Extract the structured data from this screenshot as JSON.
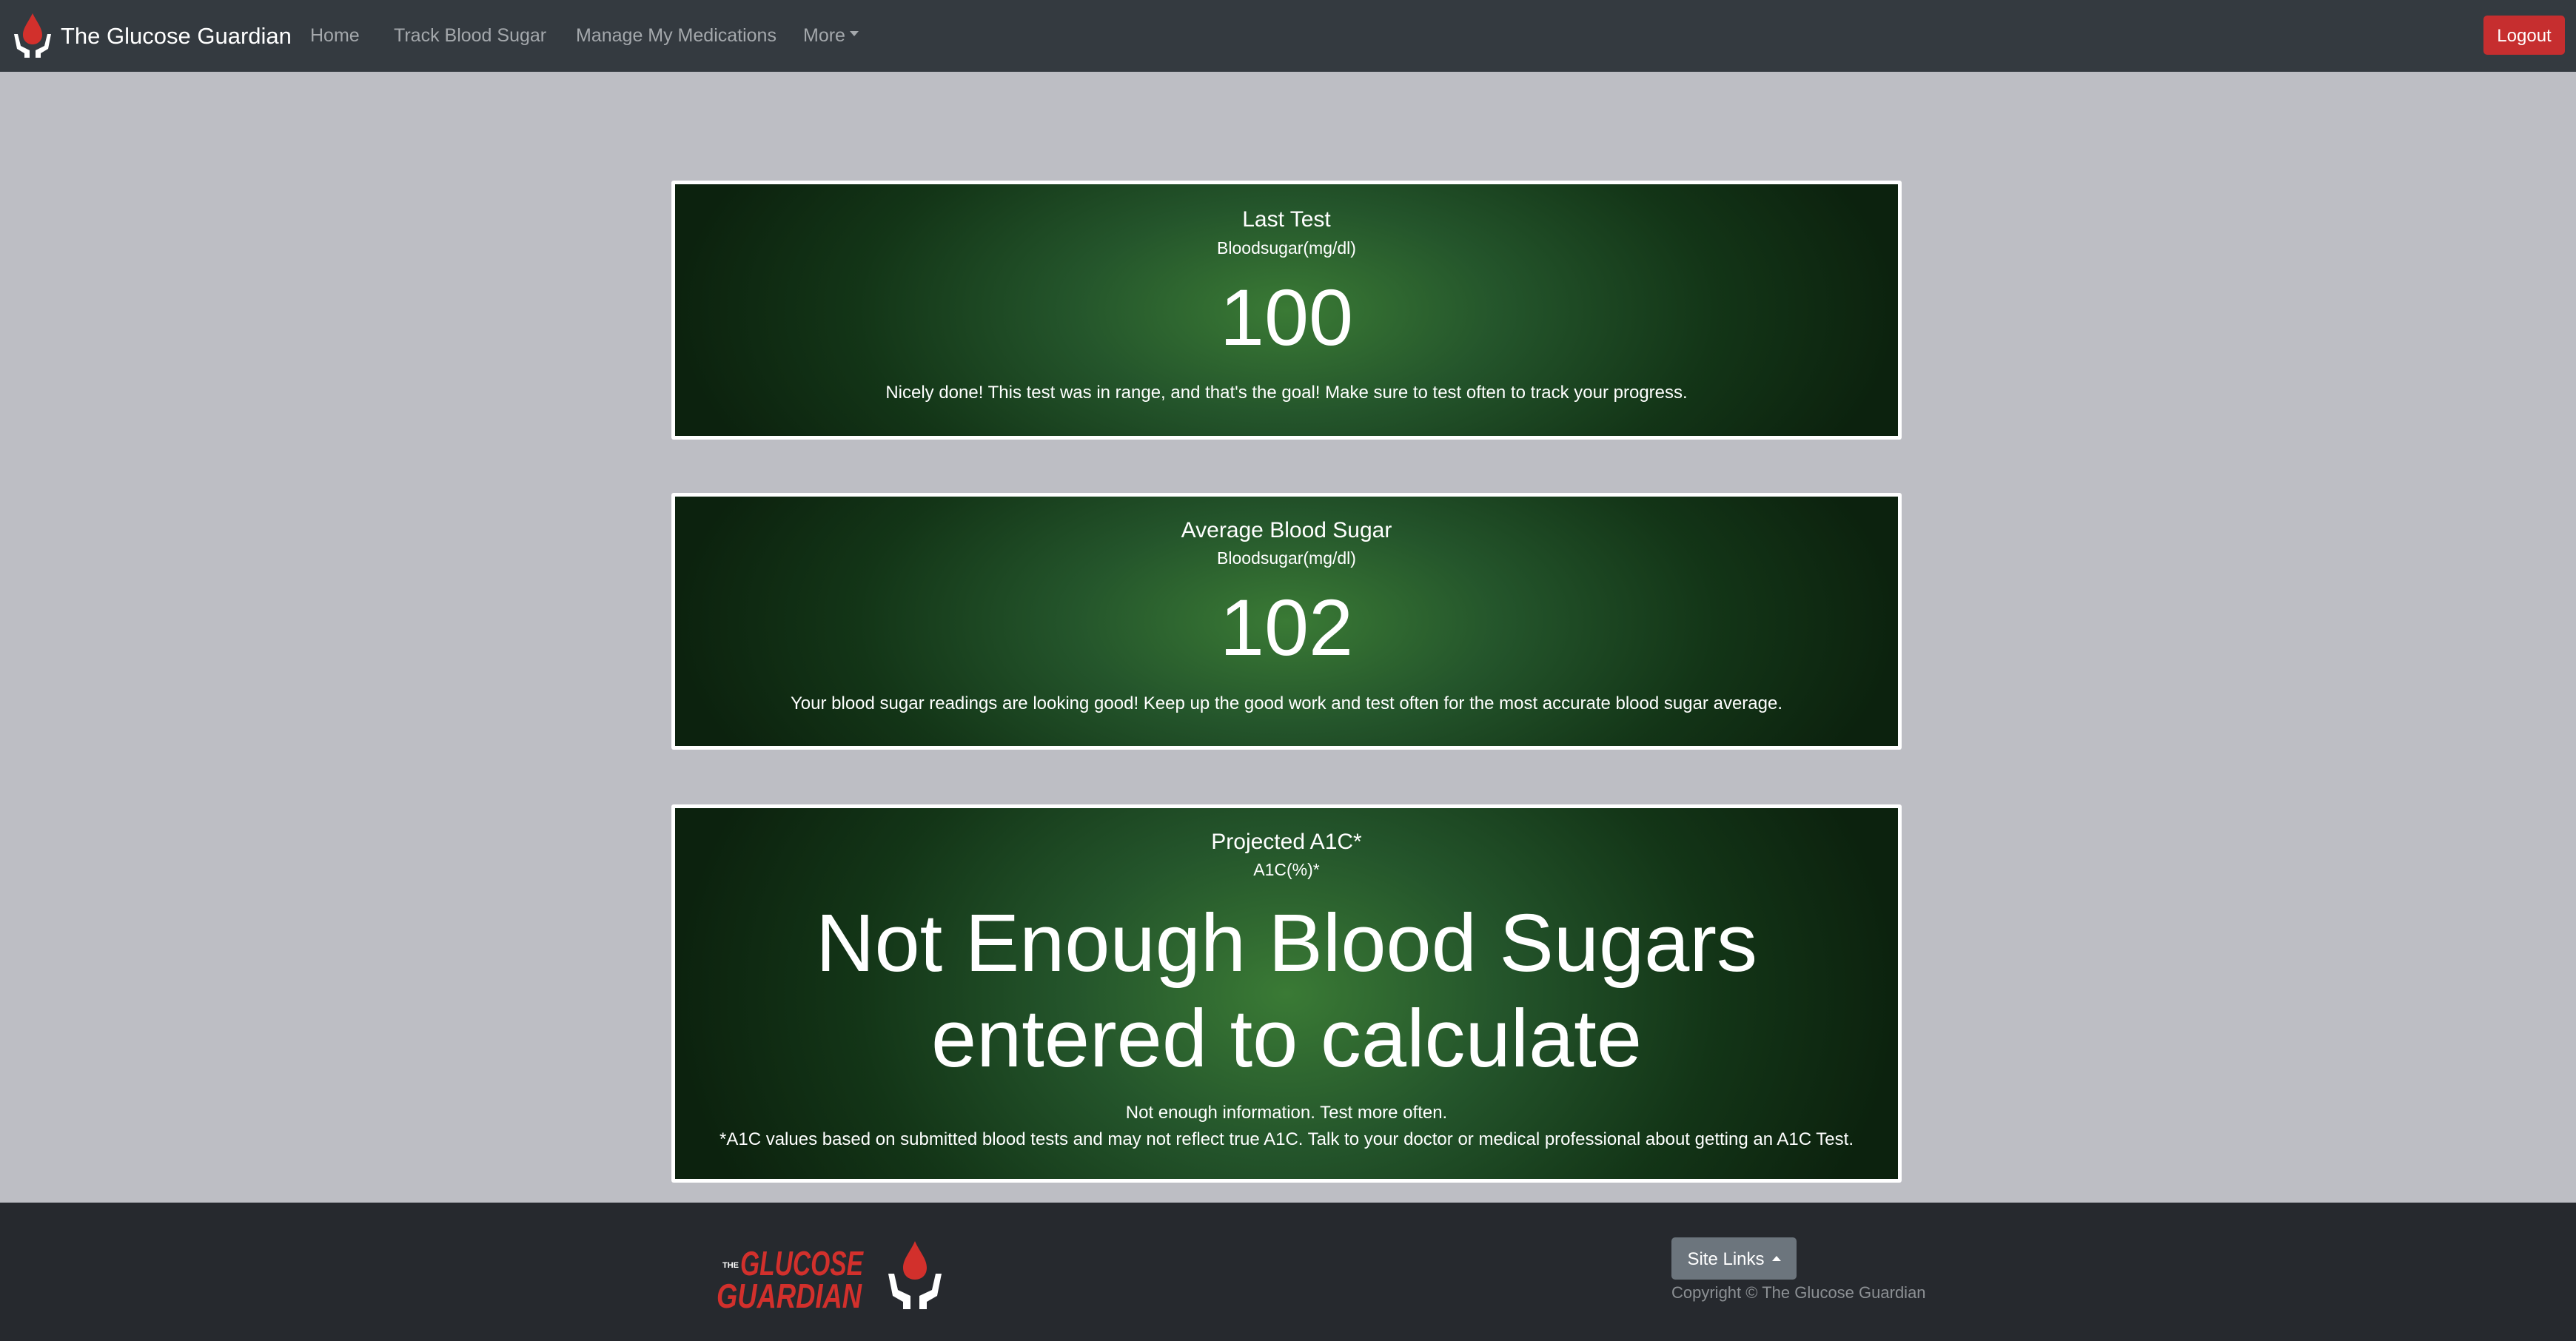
{
  "navbar": {
    "brand": "The Glucose Guardian",
    "links": [
      "Home",
      "Track Blood Sugar",
      "Manage My Medications",
      "More"
    ],
    "logout_label": "Logout"
  },
  "cards": {
    "last_test": {
      "title": "Last Test",
      "subtitle": "Bloodsugar(mg/dl)",
      "value": "100",
      "message": "Nicely done! This test was in range, and that's the goal! Make sure to test often to track your progress."
    },
    "average": {
      "title": "Average Blood Sugar",
      "subtitle": "Bloodsugar(mg/dl)",
      "value": "102",
      "message": "Your blood sugar readings are looking good! Keep up the good work and test often for the most accurate blood sugar average."
    },
    "a1c": {
      "title": "Projected A1C*",
      "subtitle": "A1C(%)*",
      "value_line1": "Not Enough Blood Sugars",
      "value_line2": "entered to calculate",
      "message": "Not enough information. Test more often.",
      "disclaimer": "*A1C values based on submitted blood tests and may not reflect true A1C. Talk to your doctor or medical professional about getting an A1C Test."
    }
  },
  "footer": {
    "logo_word1": "GLUCOSE",
    "logo_word2": "GUARDIAN",
    "logo_prefix": "THE",
    "site_links_label": "Site Links",
    "copyright": "Copyright © The Glucose Guardian"
  },
  "colors": {
    "navbar_bg": "#343a40",
    "page_bg": "#bdbec4",
    "card_green": "#24552b",
    "logout_red": "#c62e2f",
    "footer_bg": "#26292e",
    "logo_red": "#d2302c"
  },
  "icons": [
    "blood-drop-hands-icon",
    "caret-down-icon",
    "caret-up-icon"
  ]
}
